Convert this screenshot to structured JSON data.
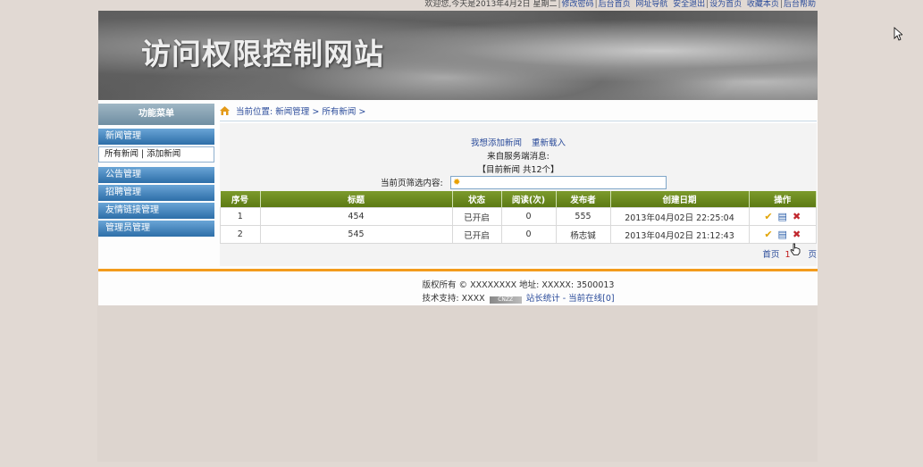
{
  "topbar": {
    "welcome": "欢迎您,今天是2013年4月2日 星期二",
    "links": [
      "修改密码",
      "后台首页",
      "网址导航",
      "安全退出",
      "设为首页",
      "收藏本页",
      "后台帮助"
    ]
  },
  "banner": {
    "title": "访问权限控制网站"
  },
  "sidebar": {
    "title": "功能菜单",
    "news_label": "新闻管理",
    "news_sub_all": "所有新闻",
    "news_sub_sep": "|",
    "news_sub_add": "添加新闻",
    "items": [
      "公告管理",
      "招聘管理",
      "友情链接管理",
      "管理员管理"
    ]
  },
  "breadcrumb": {
    "prefix": "当前位置:",
    "level1": "新闻管理",
    "level2": "所有新闻",
    "sep": ">"
  },
  "actions": {
    "add": "我想添加新闻",
    "reload": "重新载入"
  },
  "server_msg": "来自服务端消息:",
  "count_text": "【目前新闻 共12个】",
  "filter": {
    "label": "当前页筛选内容:",
    "value": ""
  },
  "table": {
    "headers": [
      "序号",
      "标题",
      "状态",
      "阅读(次)",
      "发布者",
      "创建日期",
      "操作"
    ],
    "rows": [
      [
        "1",
        "454",
        "已开启",
        "0",
        "555",
        "2013年04月02日 22:25:04"
      ],
      [
        "2",
        "545",
        "已开启",
        "0",
        "杨志铖",
        "2013年04月02日 21:12:43"
      ]
    ]
  },
  "pager": {
    "first": "首页",
    "current": "1",
    "last": "页"
  },
  "footer": {
    "copyright": "版权所有 © XXXXXXXX 地址: XXXXX: 3500013",
    "support": "技术支持: XXXX",
    "badge": "CNZZ",
    "stats": "站长统计 - 当前在线[0]"
  },
  "colors": {
    "header_green": "#6b8a1f",
    "menu_blue": "#2d6ea8",
    "accent_orange": "#f39b1c"
  }
}
